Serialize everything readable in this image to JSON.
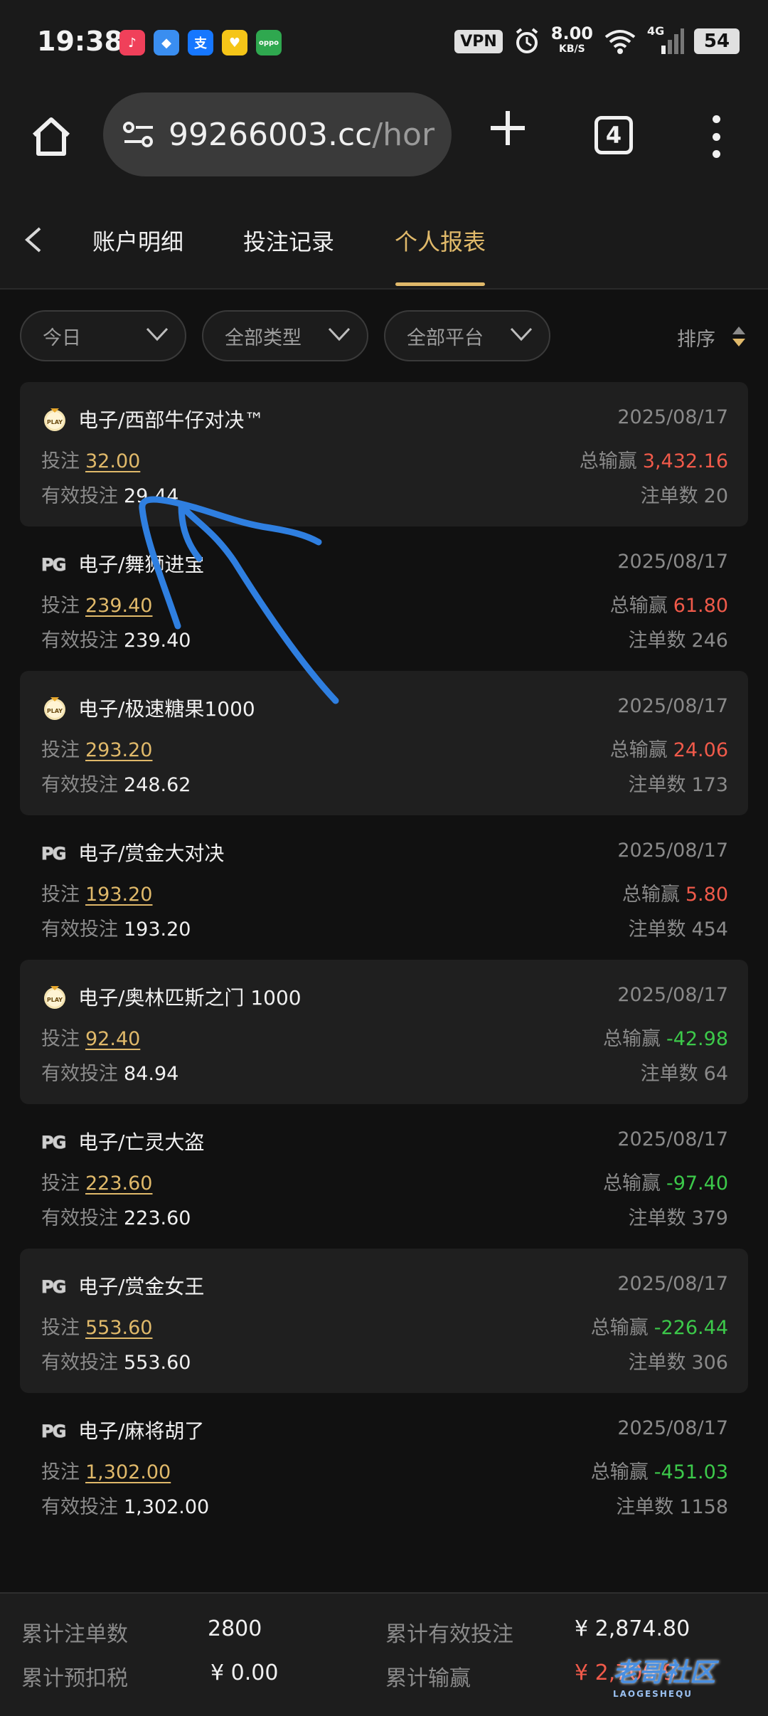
{
  "status_bar": {
    "time": "19:38",
    "vpn": "VPN",
    "speed_value": "8.00",
    "speed_unit": "KB/S",
    "network": "4G",
    "battery": "54"
  },
  "browser": {
    "url_main": "99266003.cc",
    "url_rest": "/hor",
    "tab_count": "4"
  },
  "nav": {
    "tabs": [
      {
        "label": "账户明细"
      },
      {
        "label": "投注记录"
      },
      {
        "label": "个人报表"
      }
    ],
    "active_index": 2
  },
  "filters": {
    "date": "今日",
    "type": "全部类型",
    "platform": "全部平台",
    "sort_label": "排序"
  },
  "labels": {
    "bet": "投注",
    "valid_bet": "有效投注",
    "total_win": "总输赢",
    "order_count": "注单数"
  },
  "records": [
    {
      "provider": "PLAY",
      "game": "电子/西部牛仔对决™",
      "date": "2025/08/17",
      "bet": "32.00",
      "valid_bet": "29.44",
      "win": "3,432.16",
      "win_sign": "pos",
      "count": "20"
    },
    {
      "provider": "PG",
      "game": "电子/舞狮进宝",
      "date": "2025/08/17",
      "bet": "239.40",
      "valid_bet": "239.40",
      "win": "61.80",
      "win_sign": "pos",
      "count": "246"
    },
    {
      "provider": "PLAY",
      "game": "电子/极速糖果1000",
      "date": "2025/08/17",
      "bet": "293.20",
      "valid_bet": "248.62",
      "win": "24.06",
      "win_sign": "pos",
      "count": "173"
    },
    {
      "provider": "PG",
      "game": "电子/赏金大对决",
      "date": "2025/08/17",
      "bet": "193.20",
      "valid_bet": "193.20",
      "win": "5.80",
      "win_sign": "pos",
      "count": "454"
    },
    {
      "provider": "PLAY",
      "game": "电子/奥林匹斯之门 1000",
      "date": "2025/08/17",
      "bet": "92.40",
      "valid_bet": "84.94",
      "win": "-42.98",
      "win_sign": "neg",
      "count": "64"
    },
    {
      "provider": "PG",
      "game": "电子/亡灵大盗",
      "date": "2025/08/17",
      "bet": "223.60",
      "valid_bet": "223.60",
      "win": "-97.40",
      "win_sign": "neg",
      "count": "379"
    },
    {
      "provider": "PG",
      "game": "电子/赏金女王",
      "date": "2025/08/17",
      "bet": "553.60",
      "valid_bet": "553.60",
      "win": "-226.44",
      "win_sign": "neg",
      "count": "306"
    },
    {
      "provider": "PG",
      "game": "电子/麻将胡了",
      "date": "2025/08/17",
      "bet": "1,302.00",
      "valid_bet": "1,302.00",
      "win": "-451.03",
      "win_sign": "neg",
      "count": "1158"
    }
  ],
  "summary": {
    "total_orders_label": "累计注单数",
    "total_orders": "2800",
    "total_valid_label": "累计有效投注",
    "total_valid": "¥ 2,874.80",
    "tax_label": "累计预扣税",
    "tax": "¥ 0.00",
    "total_win_label": "累计输赢",
    "total_win": "¥ 2,706.9"
  },
  "watermark": {
    "text": "老哥社区",
    "sub": "LAOGESHEQU"
  }
}
